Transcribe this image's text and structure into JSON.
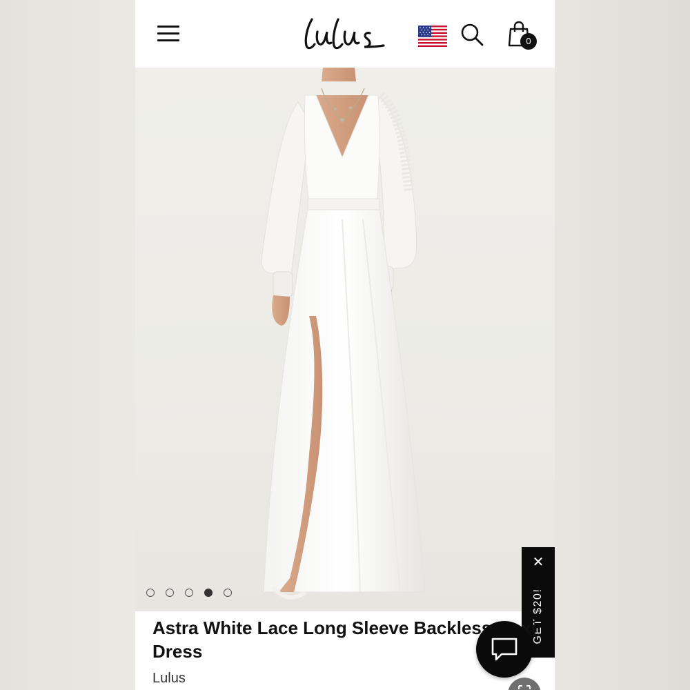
{
  "header": {
    "logo_text": "Lulus",
    "cart_count": "0",
    "icons": [
      "menu-icon",
      "us-flag-icon",
      "search-icon",
      "shopping-bag-icon"
    ]
  },
  "gallery": {
    "slide_count": 5,
    "active_slide": 4
  },
  "promo": {
    "label": "GET $20!",
    "close_glyph": "✕"
  },
  "product": {
    "title": "Astra White Lace Long Sleeve Backless Maxi Dress",
    "brand": "Lulus"
  },
  "colors": {
    "header_bg": "#ffffff",
    "photo_bg": "#ecebe6",
    "promo_bg": "#0b0b0b",
    "chat_bg": "#0a0a0a"
  }
}
